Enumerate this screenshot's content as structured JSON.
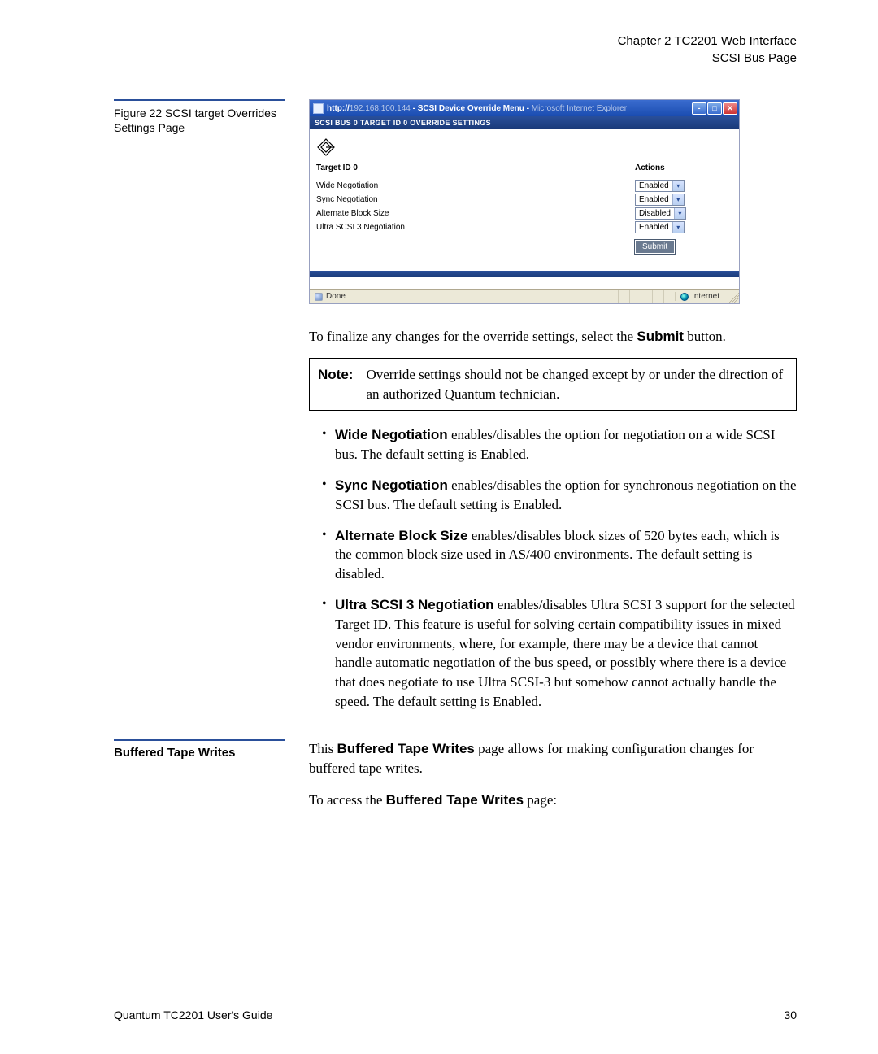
{
  "header": {
    "line1": "Chapter 2  TC2201 Web Interface",
    "line2": "SCSI Bus Page"
  },
  "figure": {
    "caption": "Figure 22  SCSI target Overrides Settings Page",
    "window": {
      "url_prefix": "http://",
      "url_ip": "192.168.100.144",
      "title_mid": " - SCSI Device Override Menu - ",
      "title_suffix": "Microsoft Internet Explorer",
      "panel_title": "SCSI BUS 0 TARGET ID 0 OVERRIDE SETTINGS",
      "col_target": "Target ID 0",
      "col_actions": "Actions",
      "rows": [
        {
          "label": "Wide Negotiation",
          "value": "Enabled"
        },
        {
          "label": "Sync Negotiation",
          "value": "Enabled"
        },
        {
          "label": "Alternate Block Size",
          "value": "Disabled"
        },
        {
          "label": "Ultra SCSI 3 Negotiation",
          "value": "Enabled"
        }
      ],
      "submit": "Submit",
      "status_done": "Done",
      "status_zone": "Internet"
    }
  },
  "body": {
    "p1a": "To finalize any changes for the override settings, select the ",
    "p1b": "Submit",
    "p1c": " button.",
    "note_label": "Note:",
    "note_text": "Override settings should not be changed except by or under the direction of an authorized Quantum technician.",
    "b1_term": "Wide Negotiation",
    "b1_text": " enables/disables the option for negotiation on a wide SCSI bus. The default setting is Enabled.",
    "b2_term": "Sync Negotiation",
    "b2_text": " enables/disables the option for synchronous negotiation on the SCSI bus. The default setting is Enabled.",
    "b3_term": "Alternate Block Size",
    "b3_text": " enables/disables block sizes of 520 bytes each, which is the common block size used in AS/400 environments. The default setting is disabled.",
    "b4_term": "Ultra SCSI 3 Negotiation",
    "b4_text": " enables/disables Ultra SCSI 3 support for the selected Target ID. This feature is useful for solving certain compatibility issues in mixed vendor environments, where, for example, there may be a device that cannot handle automatic negotiation of the bus speed, or possibly where there is a device that does negotiate to use Ultra SCSI-3 but somehow cannot actually handle the speed. The default setting is Enabled."
  },
  "section2": {
    "heading": "Buffered Tape Writes",
    "p1a": "This ",
    "p1b": "Buffered Tape Writes",
    "p1c": " page allows for making configuration changes for buffered tape writes.",
    "p2a": "To access the ",
    "p2b": "Buffered Tape Writes",
    "p2c": " page:"
  },
  "footer": {
    "left": "Quantum TC2201 User's Guide",
    "right": "30"
  }
}
